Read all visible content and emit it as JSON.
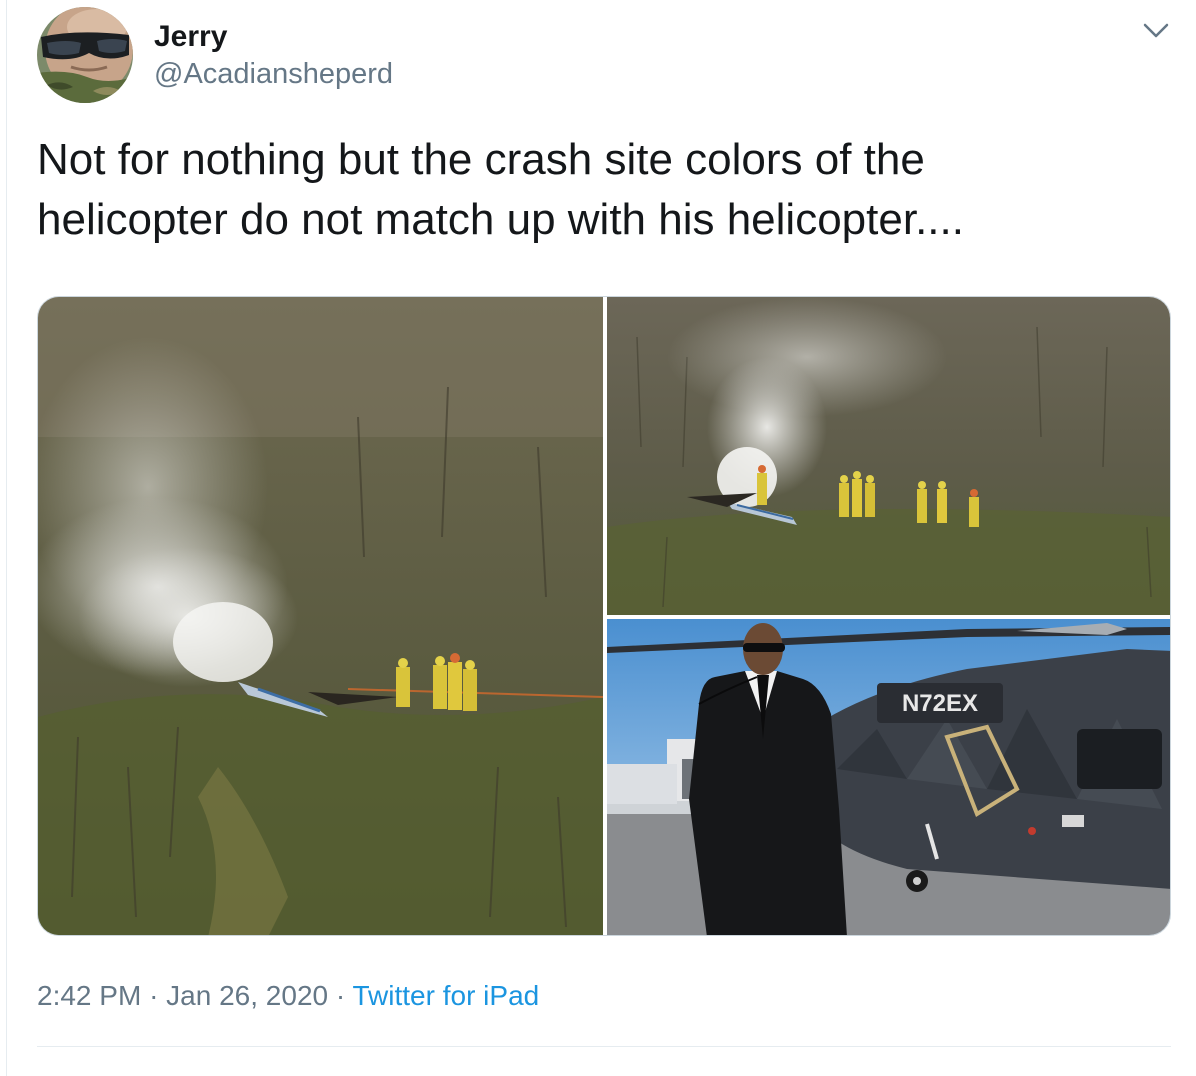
{
  "author": {
    "display_name": "Jerry",
    "handle": "@Acadiansheperd"
  },
  "tweet": {
    "text_line_1": "Not for nothing but the crash site colors of the",
    "text_line_2": "helicopter do not match up with his helicopter....",
    "time": "2:42 PM",
    "separator": "·",
    "date": "Jan 26, 2020",
    "source": "Twitter for iPad"
  },
  "media": {
    "helicopter_tail_number": "N72EX"
  },
  "colors": {
    "text_primary": "#14171a",
    "text_secondary": "#657786",
    "link": "#1b95e0",
    "divider": "#e6ecf0"
  },
  "icons": {
    "menu": "chevron-down-icon"
  }
}
